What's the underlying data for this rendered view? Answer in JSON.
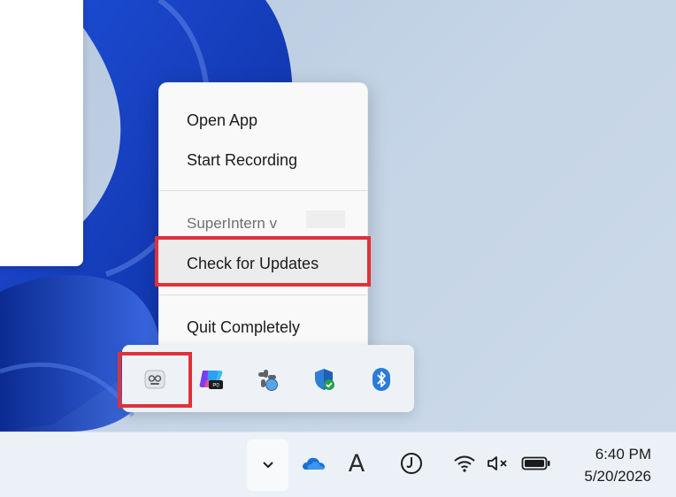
{
  "context_menu": {
    "items": [
      {
        "label": "Open App"
      },
      {
        "label": "Start Recording"
      },
      {
        "label": "SuperIntern v"
      },
      {
        "label": "Check for Updates"
      },
      {
        "label": "Quit Completely"
      }
    ]
  },
  "tray_flyout": {
    "icons": [
      "superintern-icon",
      "copilot-icon",
      "slack-icon",
      "windows-security-icon",
      "bluetooth-icon"
    ]
  },
  "taskbar": {
    "icons": [
      "chevron-up-icon",
      "onedrive-icon",
      "input-language-icon",
      "clock-app-icon",
      "wifi-icon",
      "volume-muted-icon",
      "battery-icon"
    ],
    "language_indicator": "A",
    "time": "6:40 PM",
    "date": "5/20/2026"
  },
  "colors": {
    "highlight": "#e0313a",
    "bluetooth": "#2b7bd9",
    "accent_blue": "#1a4fd1"
  }
}
